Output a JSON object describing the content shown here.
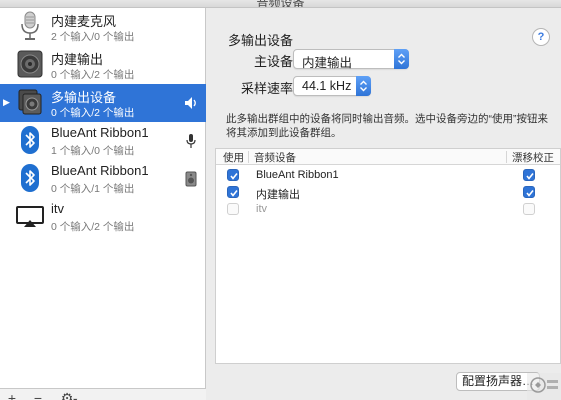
{
  "window": {
    "title": "音频设备"
  },
  "sidebar": {
    "devices": [
      {
        "name": "内建麦克风",
        "sub": "2 个输入/0 个输出",
        "icon": "microphone-icon"
      },
      {
        "name": "内建输出",
        "sub": "0 个输入/2 个输出",
        "icon": "speaker-icon"
      },
      {
        "name": "多输出设备",
        "sub": "0 个输入/2 个输出",
        "icon": "multi-output-icon",
        "selected": true
      },
      {
        "name": "BlueAnt Ribbon1",
        "sub": "1 个输入/0 个输出",
        "icon": "bluetooth-icon"
      },
      {
        "name": "BlueAnt Ribbon1",
        "sub": "0 个输入/1 个输出",
        "icon": "bluetooth-icon"
      },
      {
        "name": "itv",
        "sub": "0 个输入/2 个输出",
        "icon": "airplay-icon"
      }
    ],
    "toolbar": {
      "add": "+",
      "remove": "−",
      "gear": "⚙"
    }
  },
  "main": {
    "title": "多输出设备",
    "help": "?",
    "master_label": "主设备：",
    "master_value": "内建输出",
    "rate_label": "采样速率：",
    "rate_value": "44.1 kHz",
    "description": "此多输出群组中的设备将同时输出音频。选中设备旁边的“使用”按钮来将其添加到此设备群组。",
    "table": {
      "headers": {
        "use": "使用",
        "device": "音频设备",
        "drift": "漂移校正"
      },
      "rows": [
        {
          "device": "BlueAnt Ribbon1",
          "use": true,
          "drift": true
        },
        {
          "device": "内建输出",
          "use": true,
          "drift": true
        },
        {
          "device": "itv",
          "use": false,
          "drift": false
        }
      ]
    },
    "configure_button": "配置扬声器…"
  },
  "colors": {
    "accent": "#2f74d7",
    "sidebar_bg": "#ffffff",
    "window_bg": "#ececec"
  }
}
